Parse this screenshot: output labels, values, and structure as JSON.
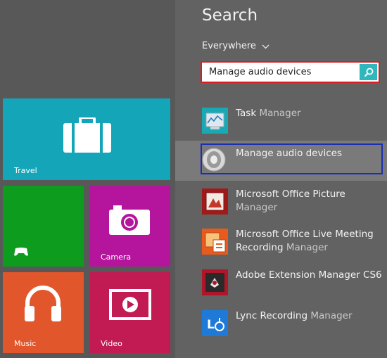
{
  "tiles": {
    "travel": {
      "label": "Travel",
      "color": "#14a5b9"
    },
    "games": {
      "label": "",
      "color": "#0e9c1e"
    },
    "camera": {
      "label": "Camera",
      "color": "#b5149d"
    },
    "music": {
      "label": "Music",
      "color": "#e1562b"
    },
    "video": {
      "label": "Video",
      "color": "#c21a53"
    }
  },
  "search": {
    "title": "Search",
    "scope_label": "Everywhere",
    "query": "Manage audio devices",
    "accent": "#2fb7bd",
    "highlight_color": "#d81e25"
  },
  "results": [
    {
      "name_main": "Task ",
      "name_rest": "Manager",
      "icon": "task-manager-icon"
    },
    {
      "name_main": "Manage audio devices",
      "name_rest": "",
      "icon": "speaker-icon",
      "selected": true
    },
    {
      "name_main": "Microsoft Office Picture ",
      "name_rest": "Manager",
      "icon": "office-picture-manager-icon"
    },
    {
      "line1": "Microsoft Office Live Meeting",
      "line2_main": "Recording ",
      "line2_rest": "Manager",
      "icon": "live-meeting-icon"
    },
    {
      "name_main": "Adobe Extension ",
      "name_rest": "Manager CS6",
      "icon": "adobe-extension-manager-icon"
    },
    {
      "name_main": "Lync Recording ",
      "name_rest": "Manager",
      "icon": "lync-recording-icon"
    }
  ]
}
